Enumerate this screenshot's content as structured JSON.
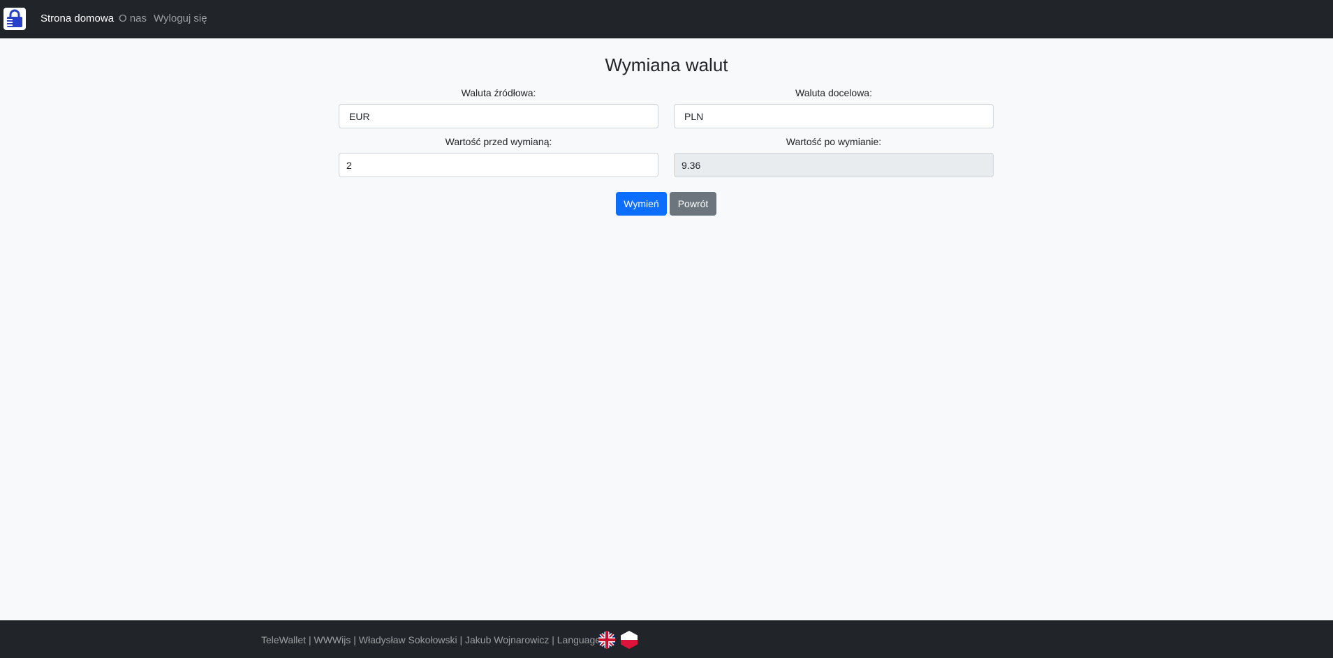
{
  "navbar": {
    "logo_icon": "lock-wallet-icon",
    "links": [
      {
        "label": "Strona domowa",
        "active": true
      },
      {
        "label": "O nas",
        "active": false
      },
      {
        "label": "Wyloguj się",
        "active": false
      }
    ]
  },
  "main": {
    "title": "Wymiana walut",
    "source_currency_label": "Waluta źródłowa:",
    "source_currency_value": "EUR",
    "target_currency_label": "Waluta docelowa:",
    "target_currency_value": "PLN",
    "amount_before_label": "Wartość przed wymianą:",
    "amount_before_value": "2",
    "amount_after_label": "Wartość po wymianie:",
    "amount_after_value": "9.36",
    "exchange_button": "Wymień",
    "back_button": "Powrót"
  },
  "footer": {
    "text": "TeleWallet | WWWijs | Władysław Sokołowski | Jakub Wojnarowicz | Languages:",
    "flags": [
      "uk-flag-icon",
      "poland-flag-icon"
    ]
  },
  "colors": {
    "navbar_bg": "#212529",
    "primary": "#0d6efd",
    "secondary": "#6c757d",
    "logo_blue": "#2741c9"
  }
}
